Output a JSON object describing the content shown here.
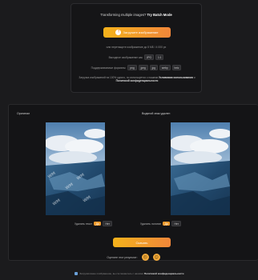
{
  "upload": {
    "batch_prefix": "Transforming multiple images?",
    "batch_link": "Try Batch Mode",
    "upload_label": "Загрузите изображение",
    "limits_text": "или перетащите изображение до 5 МБ / 4 000 px",
    "output_label": "Выходное изображение как",
    "output_value": "JPG",
    "output_size": "1:1",
    "formats_label": "Поддерживаемые форматы:",
    "formats": [
      "png",
      "jpeg",
      "jpg",
      "webp",
      "heic"
    ],
    "note_text": "Загрузка изображений на 100% одного, но используется с нашими",
    "note_terms": "Условиями использования",
    "note_and": "и",
    "note_privacy": "Политикой конфиденциальности"
  },
  "compare": {
    "original_label": "Оригинал",
    "result_label": "Водяной знак удален"
  },
  "controls": {
    "left_label": "Удалить текст",
    "left_on": "Да",
    "left_off": "Нет",
    "right_label": "Удалить логотип",
    "right_on": "Да",
    "right_off": "Нет"
  },
  "download": {
    "label": "Скачать"
  },
  "rating": {
    "label": "Оцените этот результат:",
    "icons": [
      "sad-face-icon",
      "happy-face-icon"
    ]
  },
  "footer": {
    "text": "Загрузив ваше изображение, вы соглашаетесь с нашими",
    "link": "Политикой конфиденциальности"
  },
  "colors": {
    "accent_start": "#f4b21b",
    "accent_end": "#f2873a",
    "background": "#1b1b1d"
  }
}
